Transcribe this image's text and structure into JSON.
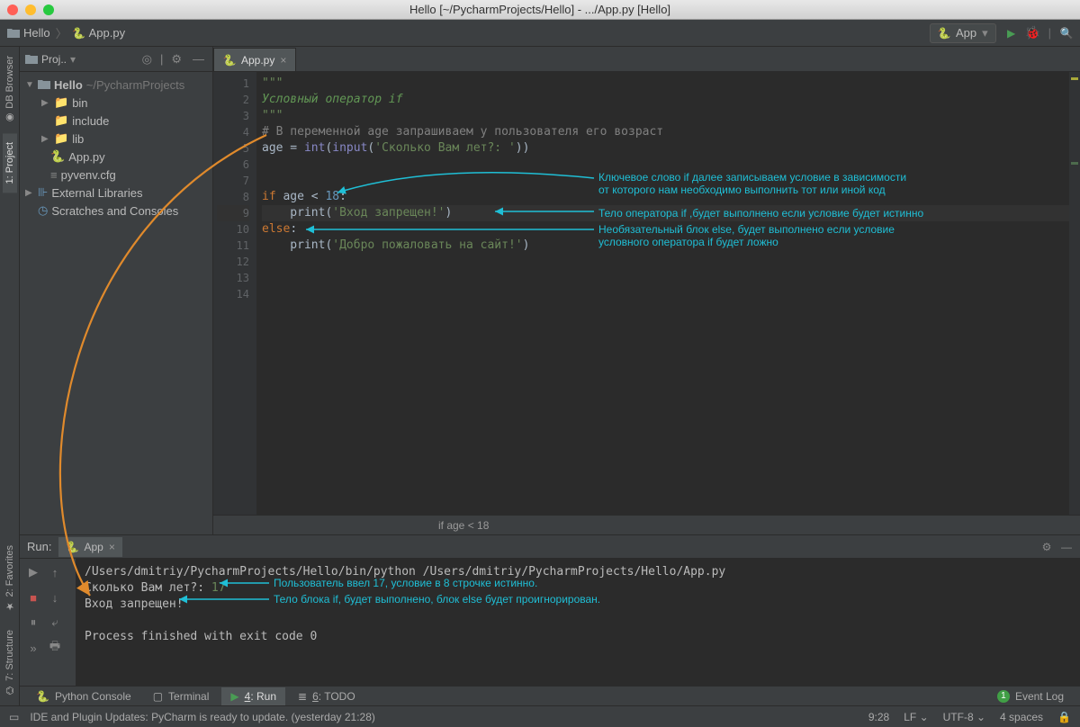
{
  "window": {
    "title": "Hello [~/PycharmProjects/Hello] - .../App.py [Hello]"
  },
  "breadcrumb": {
    "project": "Hello",
    "file": "App.py"
  },
  "runConfig": {
    "label": "App"
  },
  "leftRail": {
    "dbBrowser": "DB Browser",
    "project": "1: Project",
    "favorites": "2: Favorites",
    "structure": "7: Structure"
  },
  "sidebar": {
    "panelTitle": "Proj..",
    "root": {
      "name": "Hello",
      "path": "~/PycharmProjects"
    },
    "items": [
      "bin",
      "include",
      "lib",
      "App.py",
      "pyvenv.cfg"
    ],
    "externalLibs": "External Libraries",
    "scratches": "Scratches and Consoles"
  },
  "editor": {
    "tabLabel": "App.py",
    "lines": 14,
    "code": {
      "l1": "\"\"\"",
      "l2": "Условный оператор if",
      "l3": "\"\"\"",
      "l4": "# В переменной age запрашиваем у пользователя его возраст",
      "l5p1": "age = ",
      "l5p2": "int",
      "l5p3": "(",
      "l5p4": "input",
      "l5p5": "(",
      "l5p6": "'Сколько Вам лет?: '",
      "l5p7": "))",
      "l8p1": "if ",
      "l8p2": "age < ",
      "l8p3": "18",
      "l8p4": ":",
      "l9p1": "    print(",
      "l9p2": "'Вход запрещен!'",
      "l9p3": ")",
      "l10p1": "else",
      "l10p2": ":",
      "l11p1": "    print(",
      "l11p2": "'Добро пожаловать на сайт!'",
      "l11p3": ")"
    },
    "annotations": {
      "a1": "Ключевое слово if далее записываем условие в зависимости",
      "a1b": "от которого нам необходимо выполнить тот или иной код",
      "a2": "Тело оператора if ,будет выполнено если условие будет истинно",
      "a3": "Необязательный блок else, будет выполнено если условие",
      "a3b": "условного оператора if будет ложно"
    },
    "breadcrumbFooter": "if age < 18"
  },
  "run": {
    "label": "Run:",
    "tabLabel": "App",
    "cmd": "/Users/dmitriy/PycharmProjects/Hello/bin/python /Users/dmitriy/PycharmProjects/Hello/App.py",
    "prompt": "Сколько Вам лет?: ",
    "input": "17",
    "out1": "Вход запрещен!",
    "exit": "Process finished with exit code 0",
    "ann1": "Пользователь ввел 17, условие в 8 строчке истинно.",
    "ann2": "Тело блока if, будет выполнено, блок else будет проигнорирован."
  },
  "toolTabs": {
    "pythonConsole": "Python Console",
    "terminal": "Terminal",
    "run": "4: Run",
    "todo": "6: TODO",
    "eventLog": "Event Log",
    "eventCount": "1"
  },
  "status": {
    "msg": "IDE and Plugin Updates: PyCharm is ready to update. (yesterday 21:28)",
    "pos": "9:28",
    "lineEnding": "LF",
    "encoding": "UTF-8",
    "indent": "4 spaces"
  }
}
